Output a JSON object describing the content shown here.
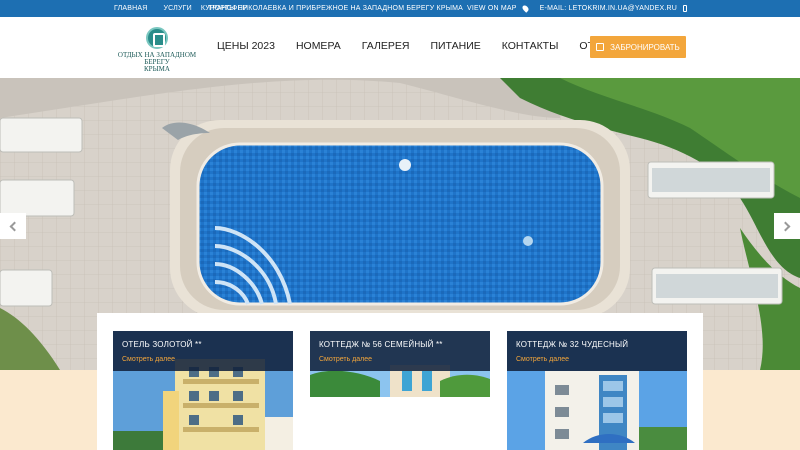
{
  "topbar": {
    "links": [
      "ГЛАВНАЯ",
      "УСЛУГИ",
      "ТРАНСФЕР"
    ],
    "resorts_text": "КУРОРТЫ НИКОЛАЕВКА И ПРИБРЕЖНОЕ НА ЗАПАДНОМ БЕРЕГУ КРЫМА",
    "view_on_map": "VIEW ON MAP",
    "email": "E-MAIL: LETOKRIM.IN.UA@YANDEX.RU"
  },
  "logo": {
    "line1": "ОТДЫХ НА ЗАПАДНОМ БЕРЕГУ",
    "line2": "КРЫМА"
  },
  "nav": [
    "ЦЕНЫ 2023",
    "НОМЕРА",
    "ГАЛЕРЕЯ",
    "ПИТАНИЕ",
    "КОНТАКТЫ",
    "ОТЗЫВЫ"
  ],
  "book_button": "ЗАБРОНИРОВАТЬ",
  "slider": {
    "slide_count": 6,
    "active_index": 5
  },
  "cards": [
    {
      "title": "ОТЕЛЬ ЗОЛОТОЙ **",
      "link": "Смотреть далее"
    },
    {
      "title": "КОТТЕДЖ № 56 СЕМЕЙНЫЙ **",
      "link": "Смотреть далее"
    },
    {
      "title": "КОТТЕДЖ № 32 ЧУДЕСНЫЙ",
      "link": "Смотреть далее"
    }
  ],
  "colors": {
    "topbar": "#1d6fb2",
    "accent": "#f3a63b",
    "card_head": "#12223c"
  }
}
